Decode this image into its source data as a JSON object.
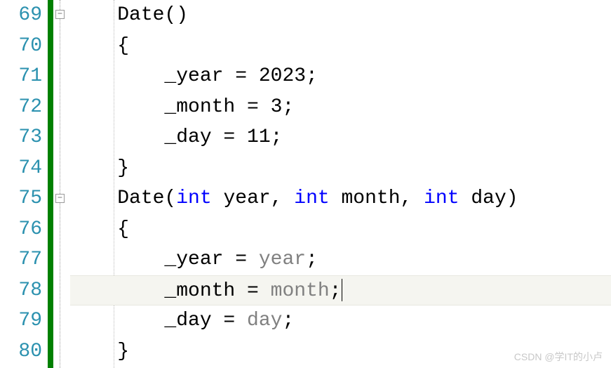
{
  "lineNumbers": [
    "69",
    "70",
    "71",
    "72",
    "73",
    "74",
    "75",
    "76",
    "77",
    "78",
    "79",
    "80"
  ],
  "code": {
    "l69": {
      "indent": "    ",
      "t1": "Date()"
    },
    "l70": {
      "indent": "    ",
      "t1": "{"
    },
    "l71": {
      "indent": "        ",
      "t1": "_year = 2023;"
    },
    "l72": {
      "indent": "        ",
      "t1": "_month = 3;"
    },
    "l73": {
      "indent": "        ",
      "t1": "_day = 11;"
    },
    "l74": {
      "indent": "    ",
      "t1": "}"
    },
    "l75": {
      "indent": "    ",
      "t1": "Date(",
      "kw1": "int",
      "t2": " year, ",
      "kw2": "int",
      "t3": " month, ",
      "kw3": "int",
      "t4": " day)"
    },
    "l76": {
      "indent": "    ",
      "t1": "{"
    },
    "l77": {
      "indent": "        ",
      "t1": "_year = ",
      "p1": "year",
      "t2": ";"
    },
    "l78": {
      "indent": "        ",
      "t1": "_month = ",
      "p1": "month",
      "t2": ";"
    },
    "l79": {
      "indent": "        ",
      "t1": "_day = ",
      "p1": "day",
      "t2": ";"
    },
    "l80": {
      "indent": "    ",
      "t1": "}"
    }
  },
  "watermark": "CSDN @学IT的小卢"
}
